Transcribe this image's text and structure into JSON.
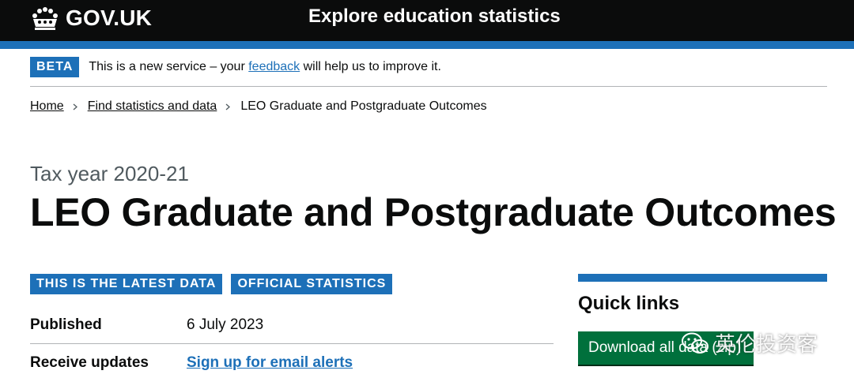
{
  "header": {
    "logo_text": "GOV.UK",
    "service_name": "Explore education statistics",
    "accent_color": "#1d70b8"
  },
  "phase_banner": {
    "tag": "BETA",
    "text_before": "This is a new service – your ",
    "link": "feedback",
    "text_after": " will help us to improve it."
  },
  "breadcrumbs": [
    {
      "label": "Home"
    },
    {
      "label": "Find statistics and data"
    },
    {
      "label": "LEO Graduate and Postgraduate Outcomes"
    }
  ],
  "caption": "Tax year 2020-21",
  "title": "LEO Graduate and Postgraduate Outcomes",
  "tags": [
    "THIS IS THE LATEST DATA",
    "OFFICIAL STATISTICS"
  ],
  "meta": {
    "published_label": "Published",
    "published_value": "6 July 2023",
    "updates_label": "Receive updates",
    "updates_link": "Sign up for email alerts"
  },
  "quick_links": {
    "heading": "Quick links",
    "download_label": "Download all data (zip)",
    "button_color": "#00703c"
  },
  "watermark": {
    "text": "英伦投资客",
    "icon": "wechat-icon"
  }
}
